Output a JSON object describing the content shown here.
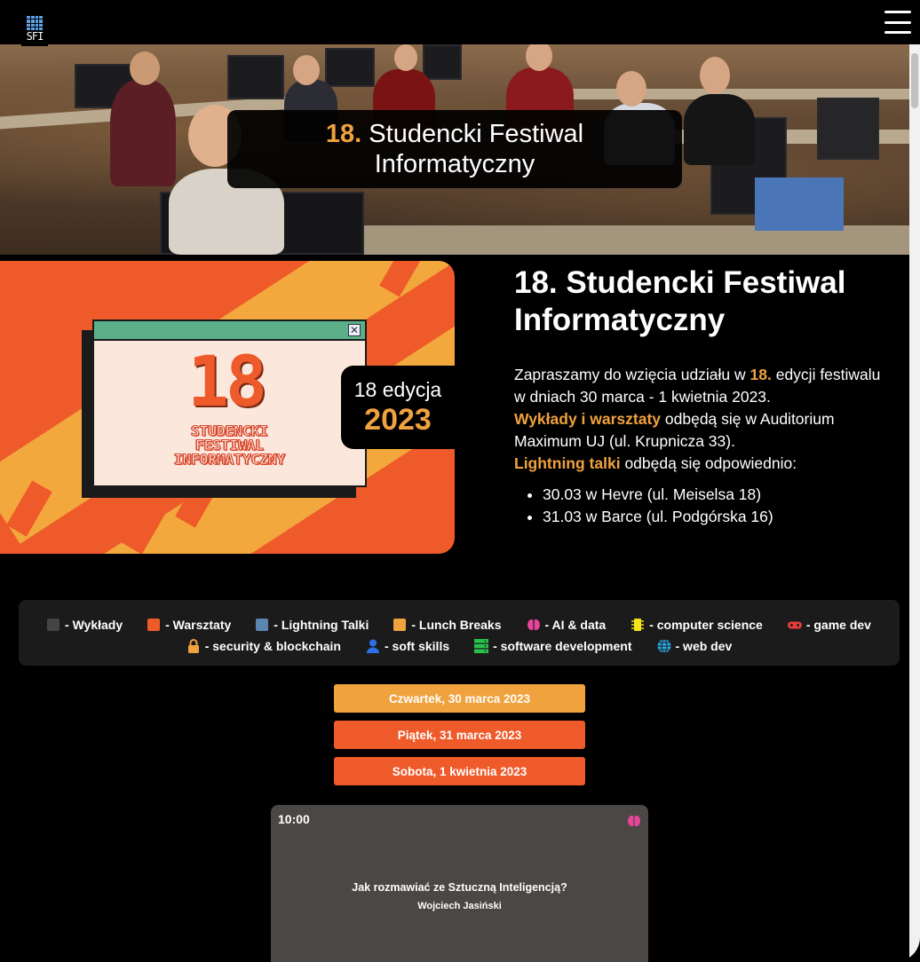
{
  "header": {
    "logo_text": "SFI",
    "menu_icon": "hamburger-menu-icon"
  },
  "hero": {
    "title_number": "18.",
    "title_line1_rest": " Studencki Festiwal",
    "title_line2": "Informatyczny"
  },
  "promo": {
    "window_number": "18",
    "window_name_lines": [
      "STUDENCKI",
      "FESTIWAL",
      "INFORMATYCZNY"
    ],
    "edition_label": "18 edycja",
    "edition_year": "2023",
    "close_icon": "close-icon",
    "colors": {
      "orange": "#ee5a2a",
      "yellow": "#f2a83c",
      "window_bar": "#5bb08a"
    }
  },
  "intro": {
    "heading": "18. Studencki Festiwal Informatyczny",
    "p1_a": "Zapraszamy do wzięcia udziału w ",
    "p1_hl": "18.",
    "p1_b": " edycji festiwalu w dniach 30 marca - 1 kwietnia 2023.",
    "p2_hl": "Wykłady i warsztaty",
    "p2_b": " odbędą się w Auditorium Maximum UJ (ul. Krupnicza 33).",
    "p3_hl": "Lightning talki",
    "p3_b": " odbędą się odpowiednio:",
    "list": [
      "30.03 w Hevre (ul. Meiselsa 18)",
      "31.03 w Barce (ul. Podgórska 16)"
    ]
  },
  "legend": {
    "row1": [
      {
        "label": "- Wykłady",
        "color": "#444444",
        "kind": "swatch"
      },
      {
        "label": "- Warsztaty",
        "color": "#ee5a2a",
        "kind": "swatch"
      },
      {
        "label": "- Lightning Talki",
        "color": "#5b86b0",
        "kind": "swatch"
      },
      {
        "label": "- Lunch Breaks",
        "color": "#f0a23e",
        "kind": "swatch"
      },
      {
        "label": "- AI & data",
        "color": "#e8459a",
        "kind": "icon",
        "icon": "brain-icon"
      },
      {
        "label": "- computer science",
        "color": "#f4e21a",
        "kind": "icon",
        "icon": "microchip-icon"
      },
      {
        "label": "- game dev",
        "color": "#e83c3c",
        "kind": "icon",
        "icon": "gamepad-icon"
      }
    ],
    "row2": [
      {
        "label": "- security & blockchain",
        "color": "#f0a23e",
        "kind": "icon",
        "icon": "lock-icon"
      },
      {
        "label": "- soft skills",
        "color": "#2f6fe6",
        "kind": "icon",
        "icon": "user-icon"
      },
      {
        "label": "- software development",
        "color": "#27c24c",
        "kind": "icon",
        "icon": "server-icon"
      },
      {
        "label": "- web dev",
        "color": "#2aa5e6",
        "kind": "icon",
        "icon": "globe-icon"
      }
    ]
  },
  "days": [
    {
      "label": "Czwartek, 30 marca 2023",
      "color": "#f0a23e"
    },
    {
      "label": "Piątek, 31 marca 2023",
      "color": "#ee5a2a"
    },
    {
      "label": "Sobota, 1 kwietnia 2023",
      "color": "#ee5a2a"
    }
  ],
  "event": {
    "time": "10:00",
    "title": "Jak rozmawiać ze Sztuczną Inteligencją?",
    "speaker": "Wojciech Jasiński",
    "tag_icon": "brain-icon",
    "tag_color": "#e8459a"
  }
}
